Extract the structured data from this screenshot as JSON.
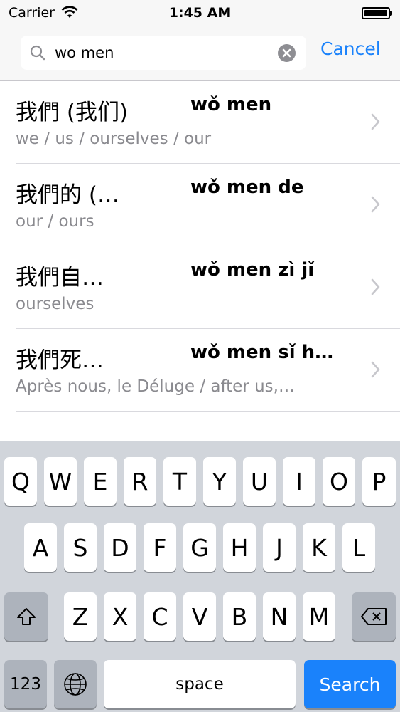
{
  "status_bar": {
    "carrier": "Carrier",
    "time": "1:45 AM"
  },
  "search": {
    "query": "wo men",
    "cancel_label": "Cancel"
  },
  "results": [
    {
      "hanzi": "我們 (我们)",
      "pinyin": "wǒ men",
      "meaning": "we / us / ourselves / our"
    },
    {
      "hanzi": "我們的 (…",
      "pinyin": "wǒ men de",
      "meaning": "our / ours"
    },
    {
      "hanzi": "我們自…",
      "pinyin": "wǒ men zì jǐ",
      "meaning": "ourselves"
    },
    {
      "hanzi": "我們死…",
      "pinyin": "wǒ men sǐ h…",
      "meaning": "Après nous, le Déluge / after us,…"
    }
  ],
  "keyboard": {
    "row1": [
      "Q",
      "W",
      "E",
      "R",
      "T",
      "Y",
      "U",
      "I",
      "O",
      "P"
    ],
    "row2": [
      "A",
      "S",
      "D",
      "F",
      "G",
      "H",
      "J",
      "K",
      "L"
    ],
    "row3": [
      "Z",
      "X",
      "C",
      "V",
      "B",
      "N",
      "M"
    ],
    "numbers_label": "123",
    "space_label": "space",
    "search_label": "Search"
  },
  "colors": {
    "accent": "#1a82fb",
    "keyboard_bg": "#d1d5db",
    "secondary_text": "#8a8a8f"
  }
}
